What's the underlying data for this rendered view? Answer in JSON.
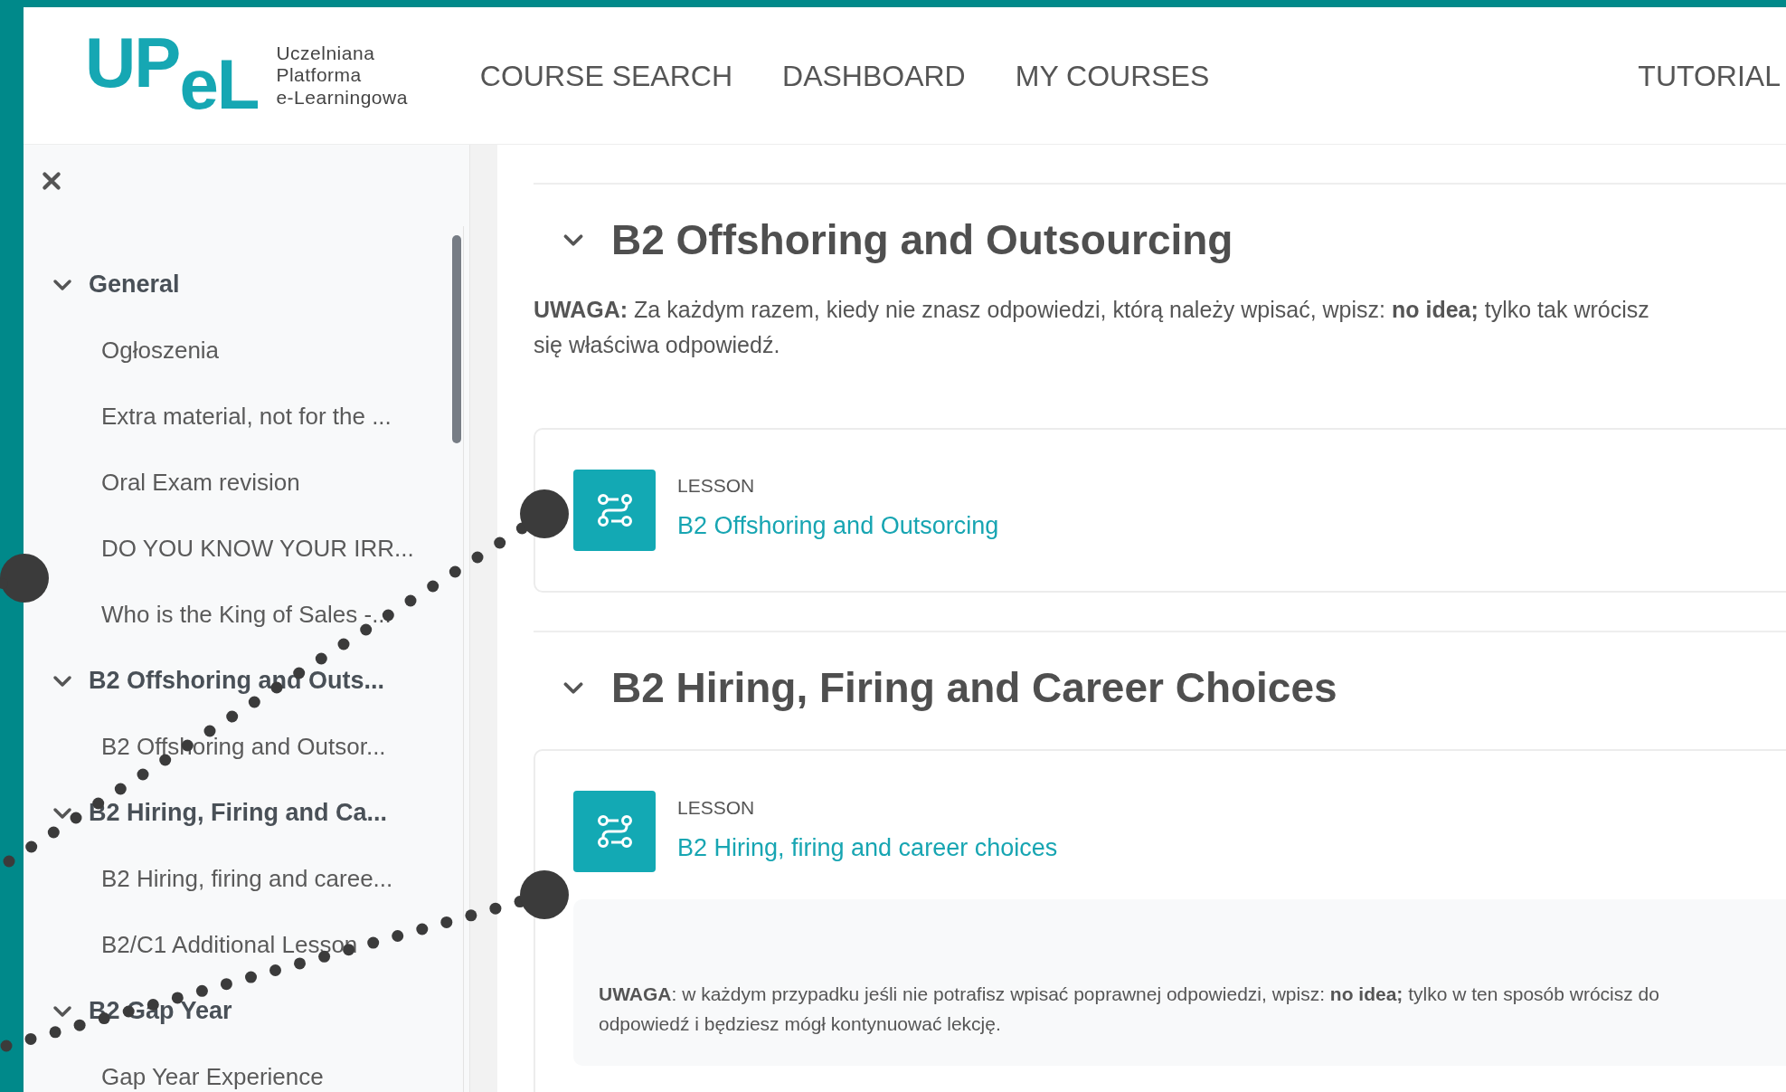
{
  "logo": {
    "mark": "UPeL",
    "subtitle": [
      "Uczelniana",
      "Platforma",
      "e-Learningowa"
    ]
  },
  "nav": {
    "items": [
      "COURSE SEARCH",
      "DASHBOARD",
      "MY COURSES"
    ],
    "right": "TUTORIAL"
  },
  "sidebar": {
    "sections": [
      {
        "title": "General",
        "expanded": true,
        "children": [
          "Ogłoszenia",
          "Extra material, not for the ...",
          "Oral Exam revision",
          "DO YOU KNOW YOUR IRR...",
          "Who is the King of Sales -..."
        ]
      },
      {
        "title": "B2 Offshoring and Outs...",
        "expanded": true,
        "children": [
          "B2 Offshoring and Outsor..."
        ]
      },
      {
        "title": "B2 Hiring, Firing and Ca...",
        "expanded": true,
        "children": [
          "B2 Hiring, firing and caree...",
          "B2/C1 Additional Lesson"
        ]
      },
      {
        "title": "B2 Gap Year",
        "expanded": true,
        "children": [
          "Gap Year Experience"
        ]
      }
    ]
  },
  "sections": [
    {
      "title": "B2 Offshoring and Outsourcing",
      "expanded": true,
      "summary": [
        "**UWAGA:** Za każdym razem, kiedy nie znasz odpowiedzi, którą należy wpisać, wpisz: **no idea;** tylko tak wrócisz",
        "się właściwa odpowiedź."
      ],
      "activities": [
        {
          "type": "LESSON",
          "name": "B2 Offshoring and Outsorcing"
        }
      ]
    },
    {
      "title": "B2 Hiring, Firing and Career Choices",
      "expanded": true,
      "activities": [
        {
          "type": "LESSON",
          "name": "B2 Hiring, firing and career choices",
          "note": [
            "**UWAGA**: w każdym przypadku jeśli nie potrafisz wpisać poprawnej odpowiedzi, wpisz:  **no idea;** tylko w ten sposób wrócisz do",
            "odpowiedź i będziesz mógł kontynuować lekcję."
          ]
        }
      ]
    }
  ]
}
